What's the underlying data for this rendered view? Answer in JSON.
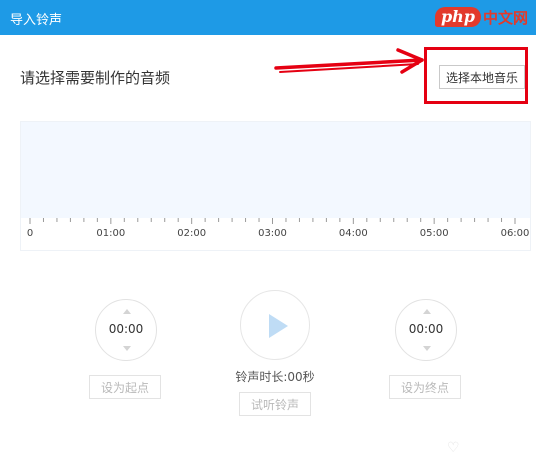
{
  "window": {
    "title": "导入铃声"
  },
  "brand": {
    "php": "php",
    "cn": "中文网"
  },
  "prompt": {
    "text": "请选择需要制作的音频"
  },
  "select_button": {
    "label": "选择本地音乐"
  },
  "annotation": {
    "color": "#e50012"
  },
  "timeline": {
    "labels": [
      "0",
      "01:00",
      "02:00",
      "03:00",
      "04:00",
      "05:00",
      "06:00"
    ]
  },
  "start_timer": {
    "value": "00:00"
  },
  "end_timer": {
    "value": "00:00"
  },
  "buttons": {
    "set_start": "设为起点",
    "set_end": "设为终点",
    "preview": "试听铃声"
  },
  "duration": {
    "text": "铃声时长:00秒"
  },
  "colors": {
    "titlebar": "#1e9ae6",
    "wave_bg": "#f3f8ff",
    "play_icon": "#bfdcf5"
  }
}
